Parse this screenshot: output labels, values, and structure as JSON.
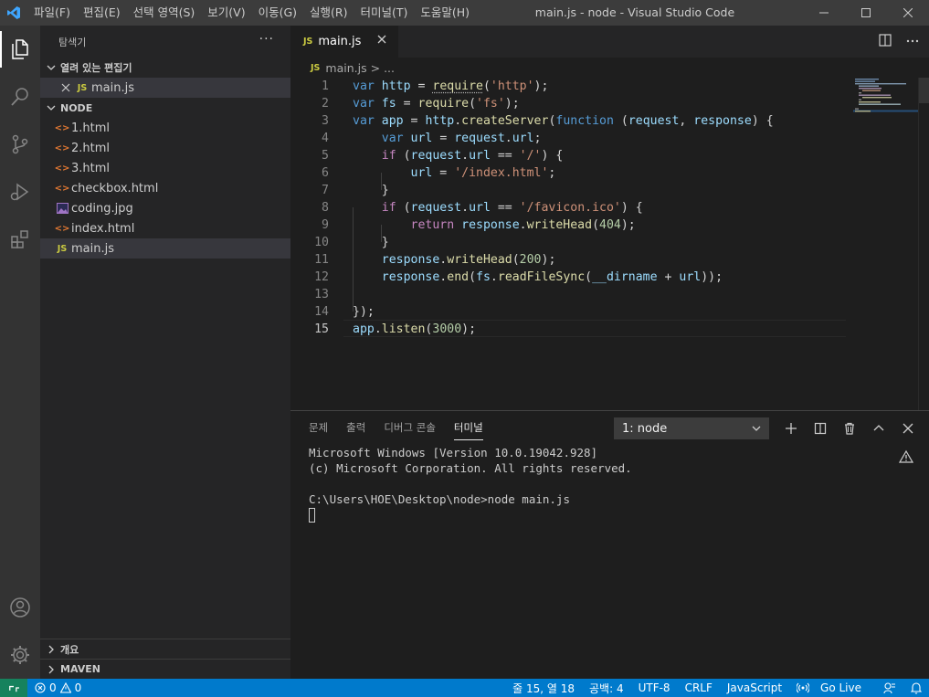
{
  "titlebar": {
    "menu": [
      "파일(F)",
      "편집(E)",
      "선택 영역(S)",
      "보기(V)",
      "이동(G)",
      "실행(R)",
      "터미널(T)",
      "도움말(H)"
    ],
    "title": "main.js - node - Visual Studio Code"
  },
  "sidebar": {
    "header": "탐색기",
    "more": "···",
    "open_editors": {
      "label": "열려 있는 편집기",
      "items": [
        {
          "badge": "JS",
          "name": "main.js"
        }
      ]
    },
    "folder": {
      "label": "NODE",
      "files": [
        {
          "name": "1.html",
          "icon": "html-icon",
          "glyph": "<>"
        },
        {
          "name": "2.html",
          "icon": "html-icon",
          "glyph": "<>"
        },
        {
          "name": "3.html",
          "icon": "html-icon",
          "glyph": "<>"
        },
        {
          "name": "checkbox.html",
          "icon": "html-icon",
          "glyph": "<>"
        },
        {
          "name": "coding.jpg",
          "icon": "image-icon",
          "glyph": ""
        },
        {
          "name": "index.html",
          "icon": "html-icon",
          "glyph": "<>"
        },
        {
          "name": "main.js",
          "icon": "js-icon",
          "glyph": "JS"
        }
      ]
    },
    "outline": "개요",
    "maven": "MAVEN"
  },
  "editor": {
    "tab": {
      "badge": "JS",
      "label": "main.js"
    },
    "breadcrumb": {
      "badge": "JS",
      "file": "main.js",
      "sep": ">",
      "rest": "..."
    },
    "line_numbers": [
      "1",
      "2",
      "3",
      "4",
      "5",
      "6",
      "7",
      "8",
      "9",
      "10",
      "11",
      "12",
      "13",
      "14",
      "15"
    ],
    "current_line": 15,
    "code": [
      "var http = require('http');",
      "var fs = require('fs');",
      "var app = http.createServer(function (request, response) {",
      "    var url = request.url;",
      "    if (request.url == '/') {",
      "        url = '/index.html';",
      "    }",
      "    if (request.url == '/favicon.ico') {",
      "        return response.writeHead(404);",
      "    }",
      "    response.writeHead(200);",
      "    response.end(fs.readFileSync(__dirname + url));",
      "",
      "});",
      "app.listen(3000);"
    ]
  },
  "panel": {
    "tabs": [
      "문제",
      "출력",
      "디버그 콘솔",
      "터미널"
    ],
    "active_tab": "터미널",
    "terminal_select": "1: node",
    "terminal_lines": [
      "Microsoft Windows [Version 10.0.19042.928]",
      "(c) Microsoft Corporation. All rights reserved.",
      "",
      "C:\\Users\\HOE\\Desktop\\node>node main.js"
    ]
  },
  "status": {
    "errors": "0",
    "warnings": "0",
    "position": "줄 15, 열 18",
    "spaces": "공백: 4",
    "encoding": "UTF-8",
    "eol": "CRLF",
    "language": "JavaScript",
    "golive": "Go Live"
  },
  "colors": {
    "titlebar": "#3c3c3c",
    "activitybar": "#333333",
    "sidebar": "#252526",
    "editor": "#1e1e1e",
    "statusbar": "#007acc",
    "remote": "#16825d"
  }
}
